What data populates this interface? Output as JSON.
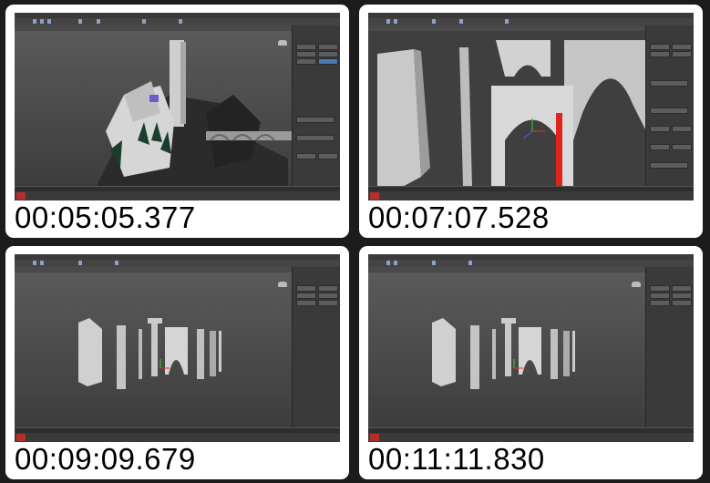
{
  "thumbnails": [
    {
      "timestamp": "00:05:05.377",
      "scene": "castle-on-cliff"
    },
    {
      "timestamp": "00:07:07.528",
      "scene": "arch-pillars-closeup"
    },
    {
      "timestamp": "00:09:09.679",
      "scene": "pillar-kit-lineup"
    },
    {
      "timestamp": "00:11:11.830",
      "scene": "pillar-kit-lineup"
    }
  ],
  "colors": {
    "page_background": "#1c1c1c",
    "card_background": "#ffffff",
    "viewport_background": "#4a4a4a",
    "selection_red": "#e0241b",
    "app_logo": "#b52d2d"
  }
}
